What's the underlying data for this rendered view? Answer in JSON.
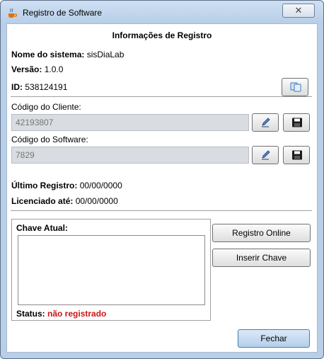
{
  "window": {
    "title": "Registro de Software",
    "close_symbol": "✕"
  },
  "header": {
    "title": "Informações de Registro"
  },
  "info": {
    "system_label": "Nome do sistema:",
    "system_value": "sisDiaLab",
    "version_label": "Versão:",
    "version_value": "1.0.0",
    "id_label": "ID:",
    "id_value": "538124191"
  },
  "client": {
    "label": "Código do Cliente:",
    "value": "42193807"
  },
  "software": {
    "label": "Código do Software:",
    "value": "7829"
  },
  "registration": {
    "last_label": "Último Registro:",
    "last_value": "00/00/0000",
    "licensed_label": "Licenciado até:",
    "licensed_value": "00/00/0000"
  },
  "key_panel": {
    "title": "Chave Atual:",
    "key_value": "",
    "status_label": "Status:",
    "status_value": "não registrado"
  },
  "buttons": {
    "online": "Registro Online",
    "insert": "Inserir Chave",
    "close": "Fechar"
  },
  "icons": {
    "copy": "copy-icon",
    "edit": "pencil-icon",
    "save": "floppy-disk-icon",
    "app": "java-cup-icon"
  },
  "colors": {
    "status": "#cc1414",
    "accent": "#3c7fb1"
  }
}
